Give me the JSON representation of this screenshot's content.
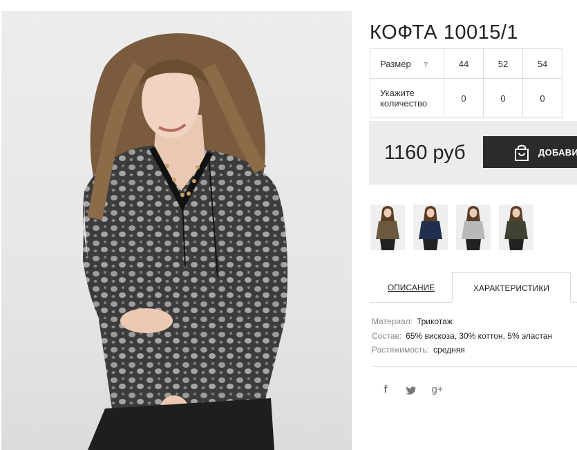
{
  "product": {
    "title": "КОФТА 10015/1",
    "image_alt": "model-wearing-grey-patterned-blouse"
  },
  "size_table": {
    "size_label": "Размер",
    "help_glyph": "?",
    "sizes": [
      "44",
      "52",
      "54"
    ],
    "quantity_label": "Укажите количество",
    "quantities": [
      "0",
      "0",
      "0"
    ]
  },
  "purchase": {
    "price": "1160 руб",
    "add_button_label": "ДОБАВИТЬ"
  },
  "thumbnails": [
    {
      "color": "#6b5a3e"
    },
    {
      "color": "#1f2f4d"
    },
    {
      "color": "#b9b9b9"
    },
    {
      "color": "#3f4331"
    }
  ],
  "tabs": {
    "description": "ОПИСАНИЕ",
    "characteristics": "ХАРАКТЕРИСТИКИ"
  },
  "specs": [
    {
      "key": "Материал:",
      "value": "Трикотаж"
    },
    {
      "key": "Состав:",
      "value": "65% вискоза, 30% коттон, 5% эластан"
    },
    {
      "key": "Растяжимость:",
      "value": "средняя"
    }
  ],
  "social": {
    "facebook": "f",
    "twitter": "t",
    "googleplus": "g+"
  }
}
